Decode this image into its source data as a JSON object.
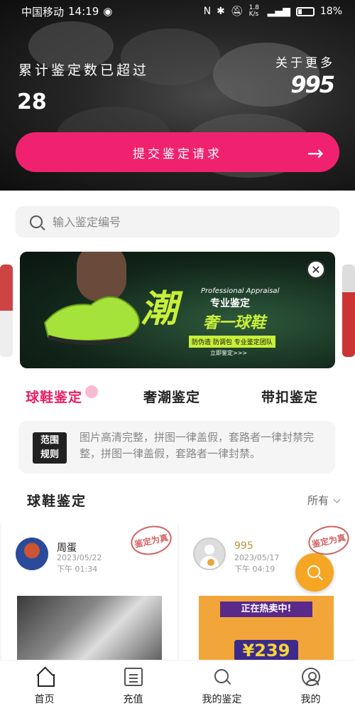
{
  "status_bar": {
    "carrier": "中国移动",
    "time": "14:19",
    "net_speed": "1.8 K/s",
    "battery": "18%"
  },
  "hero": {
    "label": "累计鉴定数已超过",
    "count": "28",
    "about": "关于更多",
    "logo": "995",
    "submit_label": "提交鉴定请求"
  },
  "search": {
    "placeholder": "输入鉴定编号"
  },
  "banner": {
    "big_text": "潮",
    "en_text": "Professional Appraisal",
    "pro_text": "专业鉴定",
    "sub_text": "奢一球鞋",
    "tag_text": "防伪造 防调包 专业鉴定团队",
    "link_text": "立即鉴定>>>"
  },
  "tabs": [
    {
      "label": "球鞋鉴定",
      "active": true
    },
    {
      "label": "奢潮鉴定",
      "active": false
    },
    {
      "label": "带扣鉴定",
      "active": false
    }
  ],
  "scope": {
    "badge_line1": "范围",
    "badge_line2": "规则",
    "text": "图片高清完整，拼图一律盖假，套路者一律封禁完整，拼图一律盖假，套路者一律封禁。"
  },
  "section": {
    "title": "球鞋鉴定",
    "filter": "所有"
  },
  "cards": [
    {
      "name": "周蛋",
      "date": "2023/05/22",
      "time": "下午 01:34",
      "stamp": "鉴定为真"
    },
    {
      "name": "995",
      "date": "2023/05/17",
      "time": "下午 04:19",
      "stamp": "鉴定为真",
      "promo_band": "正在热卖中!",
      "promo_price": "¥239"
    }
  ],
  "bottom_nav": [
    {
      "label": "首页"
    },
    {
      "label": "充值"
    },
    {
      "label": "我的鉴定"
    },
    {
      "label": "我的"
    }
  ]
}
